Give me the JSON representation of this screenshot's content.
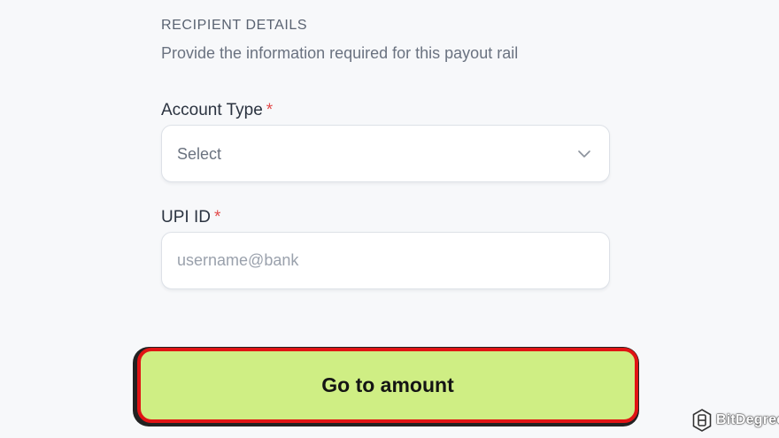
{
  "recipient": {
    "section_title": "RECIPIENT DETAILS",
    "section_subtitle": "Provide the information required for this payout rail"
  },
  "account_type": {
    "label": "Account Type",
    "required_mark": "*",
    "selected_value": "Select",
    "chevron_icon": "chevron-down-icon"
  },
  "upi_id": {
    "label": "UPI ID",
    "required_mark": "*",
    "value": "",
    "placeholder": "username@bank"
  },
  "cta": {
    "label": "Go to amount",
    "highlight_color": "#e01414",
    "background_color": "#cfee84"
  },
  "watermark": {
    "brand": "BitDegree",
    "logo_icon": "bitdegree-logo-icon"
  }
}
